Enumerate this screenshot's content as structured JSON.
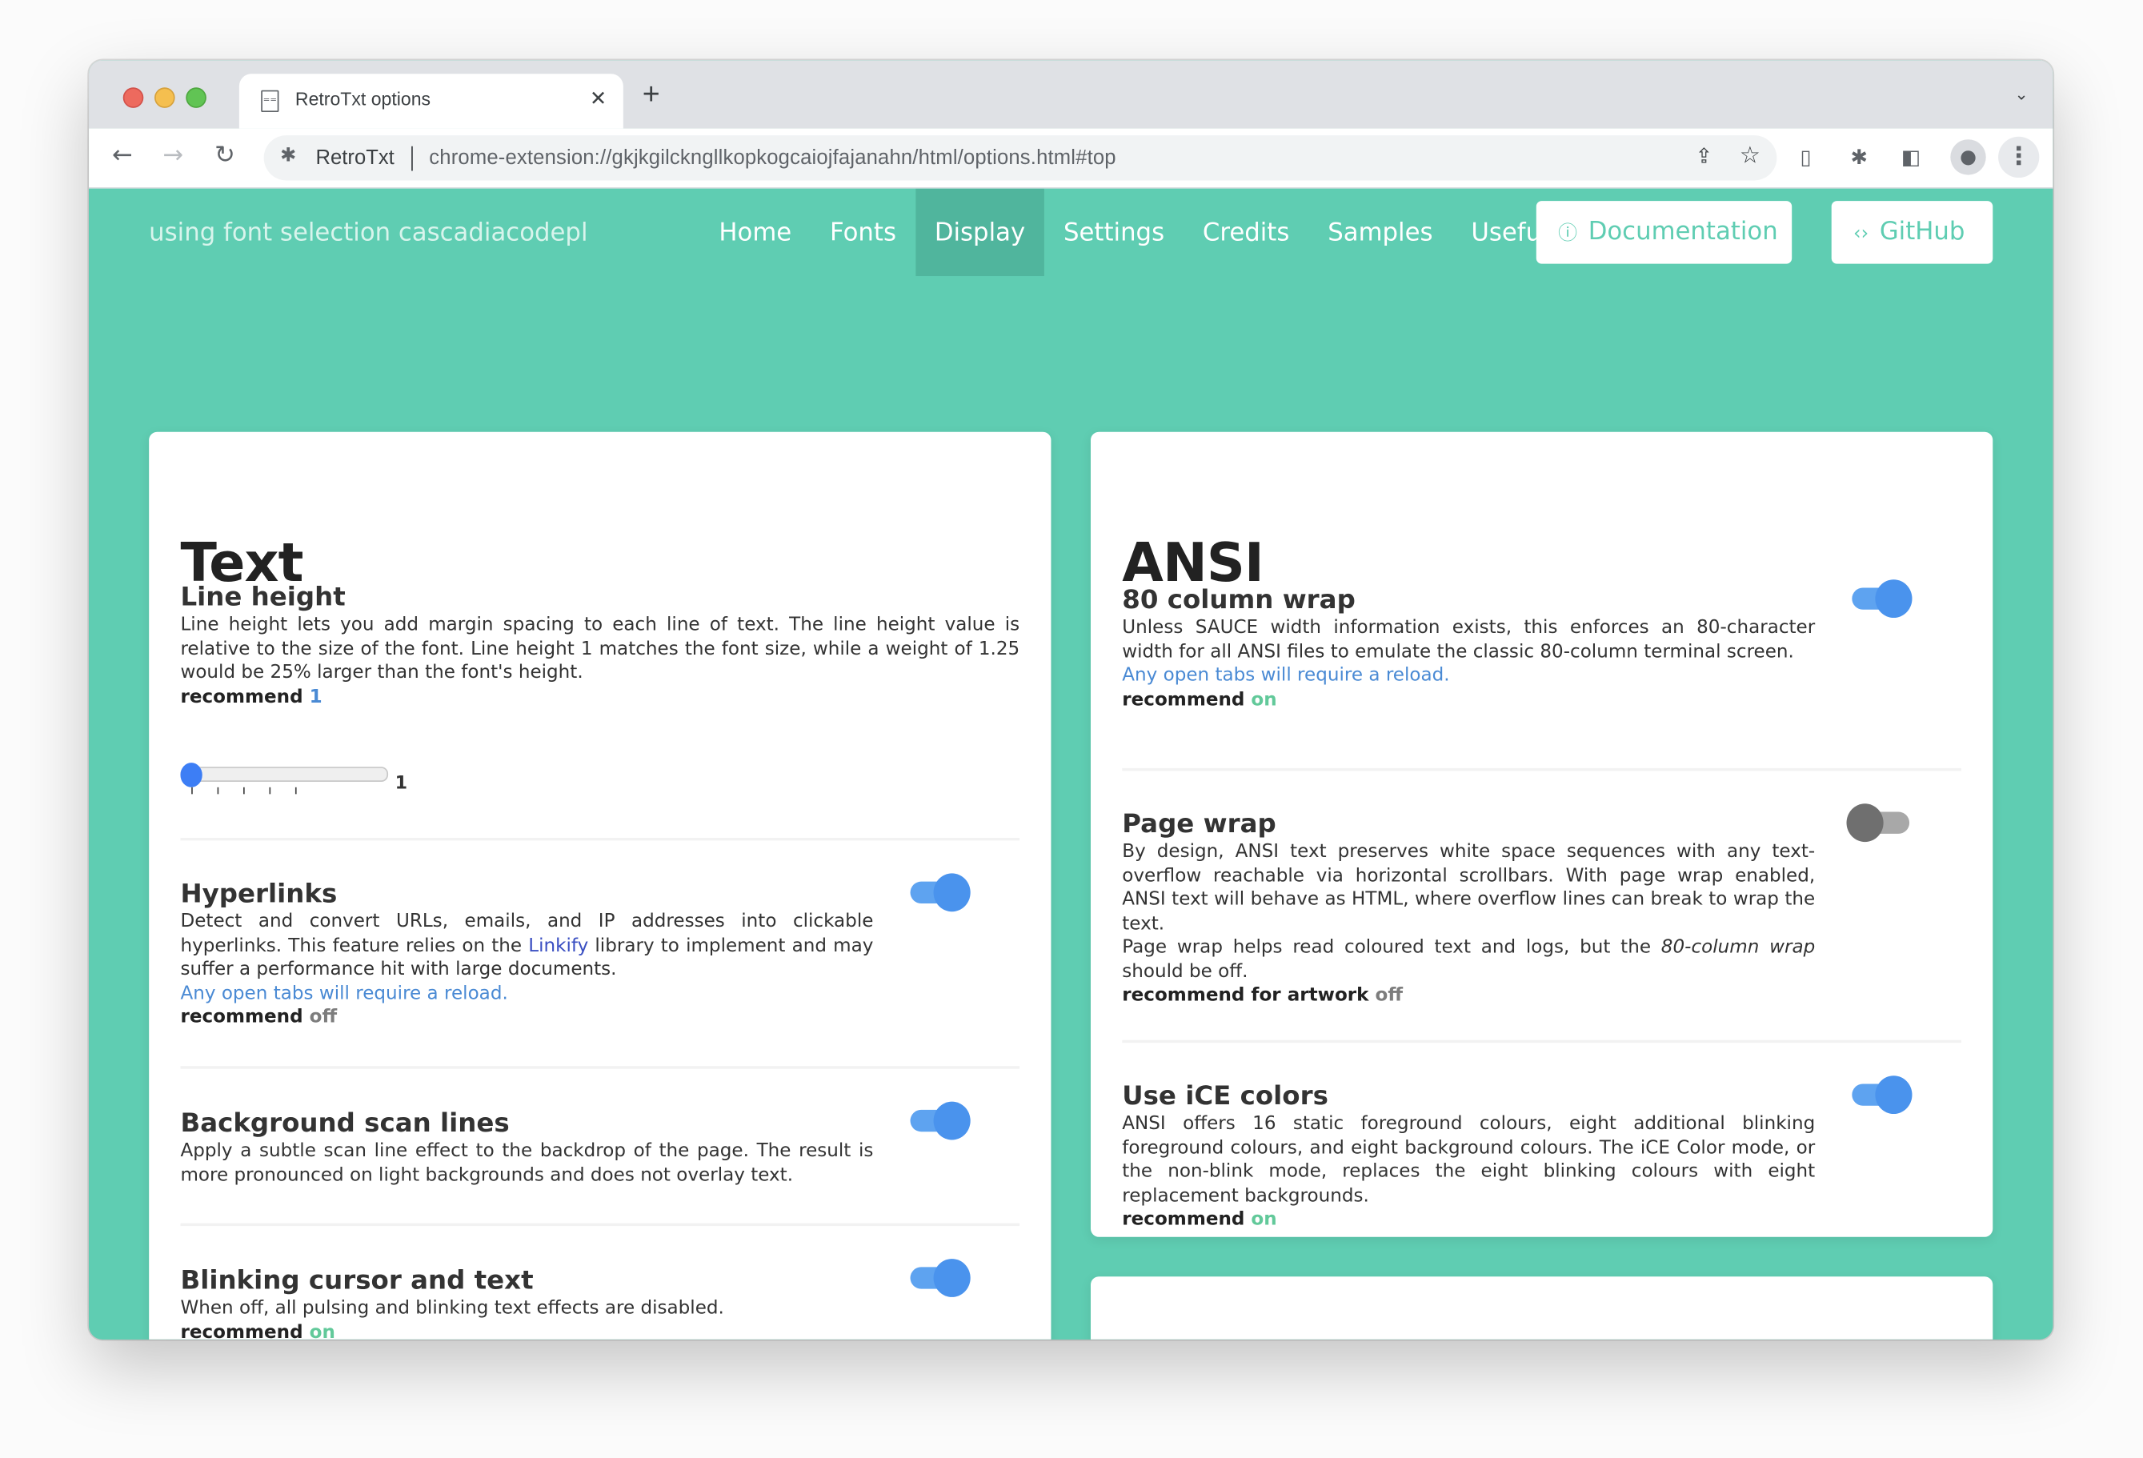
{
  "browser": {
    "tab_title": "RetroTxt options",
    "tab_close": "✕",
    "new_tab": "+",
    "tab_menu": "⌄",
    "site_label": "RetroTxt",
    "url": "chrome-extension://gkjkgilckngllkopkogcaiojfajanahn/html/options.html#top",
    "icons": {
      "back": "←",
      "forward": "→",
      "reload": "↻",
      "extension": "✱",
      "share": "⇪",
      "star": "☆",
      "retrotxt_ext": "▯",
      "puzzle": "✱",
      "side_panel": "◧",
      "profile": "●",
      "kebab": "⋮"
    }
  },
  "header": {
    "font_note": "using font selection cascadiacodepl",
    "nav": [
      {
        "label": "Home",
        "active": false
      },
      {
        "label": "Fonts",
        "active": false
      },
      {
        "label": "Display",
        "active": true
      },
      {
        "label": "Settings",
        "active": false
      },
      {
        "label": "Credits",
        "active": false
      },
      {
        "label": "Samples",
        "active": false
      },
      {
        "label": "Useful",
        "active": false
      }
    ],
    "documentation_button": {
      "icon": "ⓘ",
      "label": "Documentation"
    },
    "github_button": {
      "icon": "‹›",
      "label": "GitHub"
    }
  },
  "text_card": {
    "title": "Text",
    "line_height": {
      "heading": "Line height",
      "description": "Line height lets you add margin spacing to each line of text. The line height value is relative to the size of the font. Line height 1 matches the font size, while a weight of 1.25 would be 25% larger than the font's height.",
      "recommend_label": "recommend",
      "recommend_value": "1",
      "slider_value": 1,
      "slider_value_label": "1"
    },
    "hyperlinks": {
      "heading": "Hyperlinks",
      "description_before": "Detect and convert URLs, emails, and IP addresses into clickable hyperlinks. This feature relies on the ",
      "link_text": "Linkify",
      "description_after": " library to implement and may suffer a performance hit with large documents.",
      "reload_note": "Any open tabs will require a reload.",
      "recommend_label": "recommend",
      "recommend_value": "off",
      "enabled": true
    },
    "scan_lines": {
      "heading": "Background scan lines",
      "description": "Apply a subtle scan line effect to the backdrop of the page. The result is more pronounced on light backgrounds and does not overlay text.",
      "enabled": true
    },
    "blinking": {
      "heading": "Blinking cursor and text",
      "description": "When off, all pulsing and blinking text effects are disabled.",
      "recommend_label": "recommend",
      "recommend_value": "on",
      "enabled": true
    }
  },
  "ansi_card": {
    "title": "ANSI",
    "column_wrap": {
      "heading": "80 column wrap",
      "description": "Unless SAUCE width information exists, this enforces an 80-character width for all ANSI files to emulate the classic 80-column terminal screen.",
      "reload_note": "Any open tabs will require a reload.",
      "recommend_label": "recommend",
      "recommend_value": "on",
      "enabled": true
    },
    "page_wrap": {
      "heading": "Page wrap",
      "description": "By design, ANSI text preserves white space sequences with any text-overflow reachable via horizontal scrollbars. With page wrap enabled, ANSI text will behave as HTML, where overflow lines can break to wrap the text.",
      "description2_before": "Page wrap helps read coloured text and logs, but the ",
      "description2_em": "80-column wrap",
      "description2_after": " should be off.",
      "recommend_label": "recommend for artwork",
      "recommend_value": "off",
      "enabled": false
    },
    "ice_colors": {
      "heading": "Use iCE colors",
      "description": "ANSI offers 16 static foreground colours, eight additional blinking foreground colours, and eight background colours. The iCE Color mode, or the non-blink mode, replaces the eight blinking colours with eight replacement backgrounds.",
      "recommend_label": "recommend",
      "recommend_value": "on",
      "enabled": true
    }
  },
  "colors": {
    "page_bg": "#5fcdb2",
    "active_nav": "#50b59d",
    "toggle_on": "#4a93ed",
    "toggle_off": "#6f6f6f",
    "recommend_on": "#62c99a",
    "recommend_off": "#7d7d7d",
    "reload_note": "#4a8ad4"
  }
}
